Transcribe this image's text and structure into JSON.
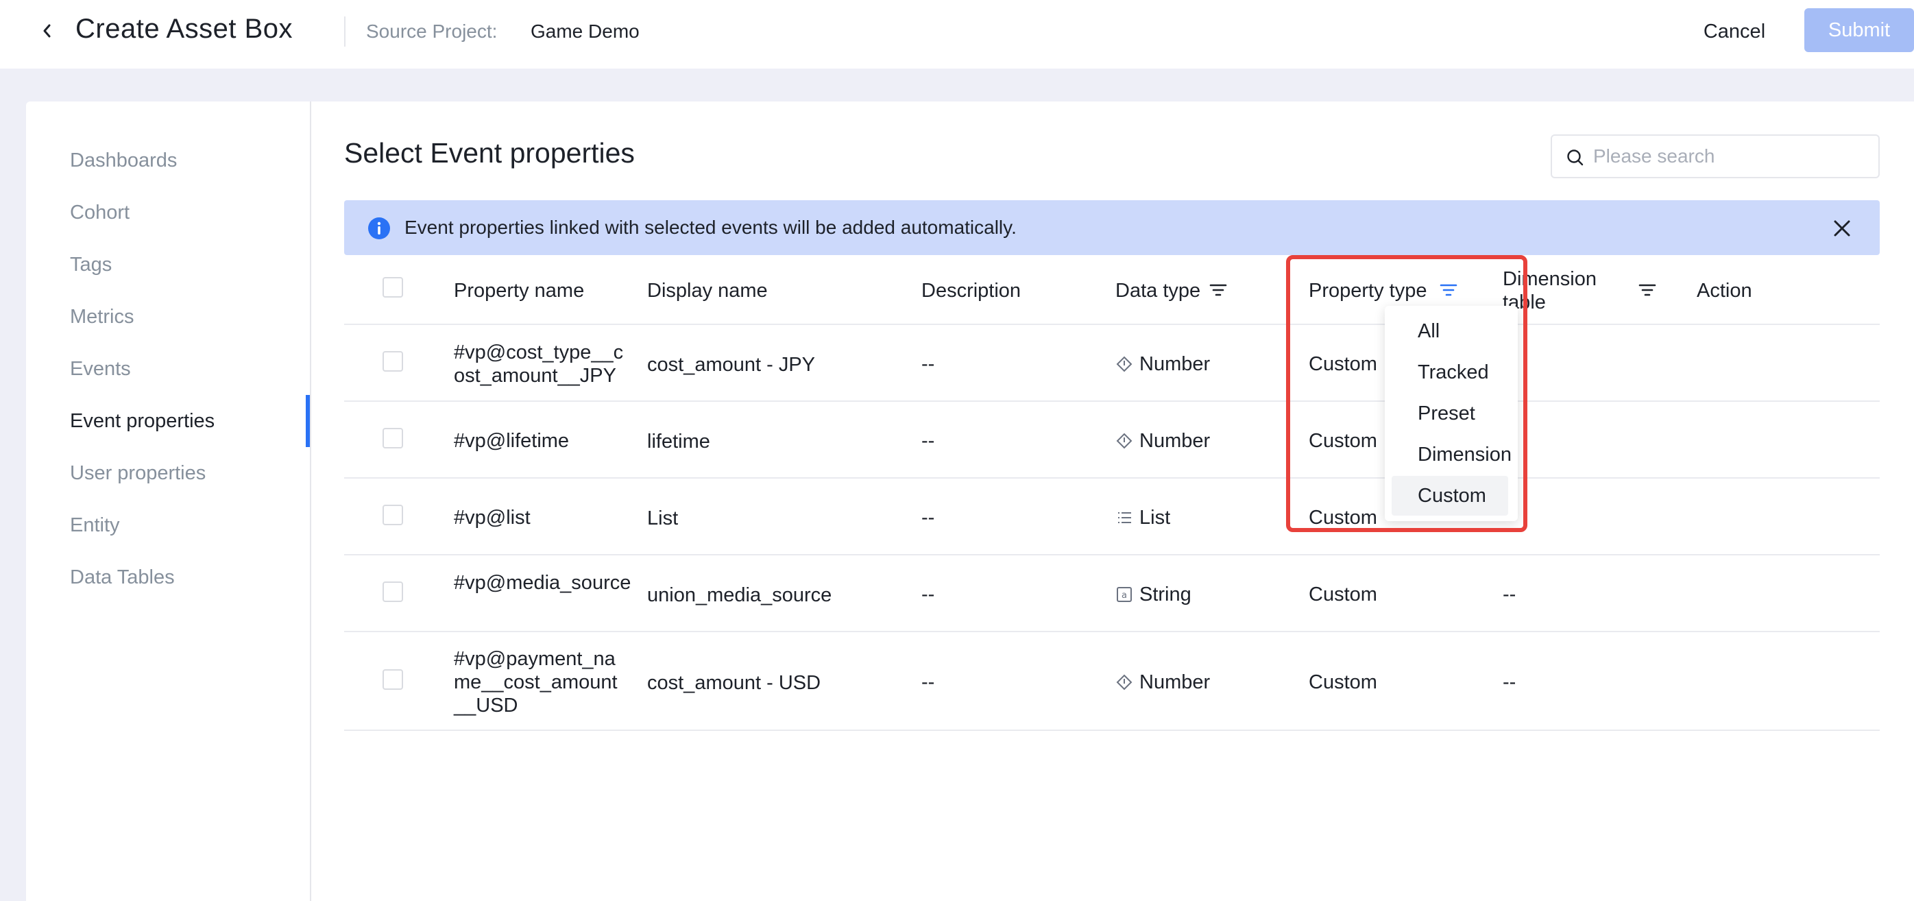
{
  "header": {
    "title": "Create Asset Box",
    "source_label": "Source Project:",
    "source_value": "Game Demo",
    "cancel_label": "Cancel",
    "submit_label": "Submit"
  },
  "sidebar": {
    "items": [
      {
        "label": "Dashboards"
      },
      {
        "label": "Cohort"
      },
      {
        "label": "Tags"
      },
      {
        "label": "Metrics"
      },
      {
        "label": "Events"
      },
      {
        "label": "Event properties",
        "active": true
      },
      {
        "label": "User properties"
      },
      {
        "label": "Entity"
      },
      {
        "label": "Data Tables"
      }
    ]
  },
  "main": {
    "title": "Select Event properties",
    "search_placeholder": "Please search",
    "notice": "Event properties linked with selected events will be added automatically."
  },
  "table": {
    "headers": {
      "property_name": "Property name",
      "display_name": "Display name",
      "description": "Description",
      "data_type": "Data type",
      "property_type": "Property type",
      "dimension_table": "Dimension table",
      "action": "Action"
    },
    "rows": [
      {
        "property_name": "#vp@cost_type__cost_amount__JPY",
        "display_name": "cost_amount - JPY",
        "description": "--",
        "data_type": "Number",
        "data_type_icon": "number-icon",
        "property_type": "Custom",
        "dimension_table": "--"
      },
      {
        "property_name": "#vp@lifetime",
        "display_name": "lifetime",
        "description": "--",
        "data_type": "Number",
        "data_type_icon": "number-icon",
        "property_type": "Custom",
        "dimension_table": "--"
      },
      {
        "property_name": "#vp@list",
        "display_name": "List",
        "description": "--",
        "data_type": "List",
        "data_type_icon": "list-icon",
        "property_type": "Custom",
        "dimension_table": "--"
      },
      {
        "property_name": "#vp@media_source",
        "display_name": "union_media_source",
        "description": "--",
        "data_type": "String",
        "data_type_icon": "string-icon",
        "property_type": "Custom",
        "dimension_table": "--"
      },
      {
        "property_name": "#vp@payment_name__cost_amount__USD",
        "display_name": "cost_amount - USD",
        "description": "--",
        "data_type": "Number",
        "data_type_icon": "number-icon",
        "property_type": "Custom",
        "dimension_table": "--"
      }
    ]
  },
  "property_type_filter": {
    "options": [
      "All",
      "Tracked",
      "Preset",
      "Dimension",
      "Custom"
    ],
    "selected": "Custom"
  },
  "colors": {
    "accent": "#2a72f5",
    "submit_disabled": "#a5bdf6",
    "notice_bg": "#ccd9fb",
    "highlight": "#e8413b"
  }
}
